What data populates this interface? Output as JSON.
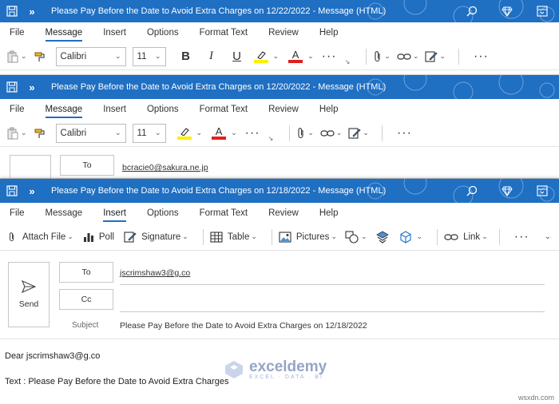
{
  "windows": [
    {
      "title": "Please Pay Before the Date to Avoid Extra Charges on 12/22/2022  -  Message (HTML)",
      "tabs": [
        "File",
        "Message",
        "Insert",
        "Options",
        "Format Text",
        "Review",
        "Help"
      ],
      "active_tab": "Message",
      "font_name": "Calibri",
      "font_size": "11"
    },
    {
      "title": "Please Pay Before the Date to Avoid Extra Charges on 12/20/2022  -  Message (HTML)",
      "tabs": [
        "File",
        "Message",
        "Insert",
        "Options",
        "Format Text",
        "Review",
        "Help"
      ],
      "active_tab": "Message",
      "font_name": "Calibri",
      "font_size": "11",
      "to_label": "To",
      "to_value": "bcracie0@sakura.ne.jp"
    },
    {
      "title": "Please Pay Before the Date to Avoid Extra Charges on 12/18/2022  -  Message (HTML)",
      "tabs": [
        "File",
        "Message",
        "Insert",
        "Options",
        "Format Text",
        "Review",
        "Help"
      ],
      "active_tab": "Insert",
      "insert_ribbon": {
        "attach_file": "Attach File",
        "poll": "Poll",
        "signature": "Signature",
        "table": "Table",
        "pictures": "Pictures",
        "link": "Link"
      },
      "send_label": "Send",
      "to_label": "To",
      "to_value": "jscrimshaw3@g.co",
      "cc_label": "Cc",
      "cc_value": "",
      "subject_label": "Subject",
      "subject_value": "Please Pay Before the Date to Avoid Extra Charges on 12/18/2022",
      "body_greeting": "Dear jscrimshaw3@g.co",
      "body_text": "Text : Please Pay Before the Date to Avoid Extra Charges"
    }
  ],
  "watermark": {
    "name": "exceldemy",
    "tagline": "EXCEL · DATA · BI"
  },
  "site_credit": "wsxdn.com",
  "colors": {
    "titlebar": "#1f6fc3",
    "highlight_yellow": "#ffef00",
    "font_color_red": "#e02020"
  }
}
